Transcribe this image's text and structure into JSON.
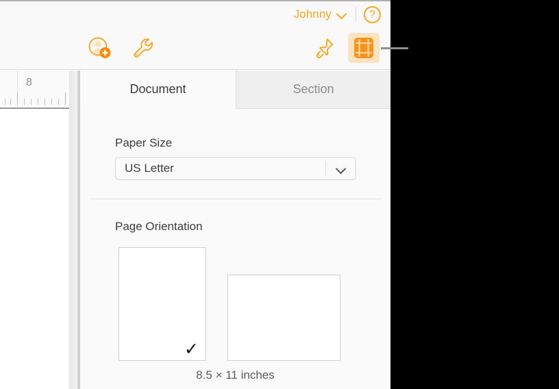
{
  "window": {
    "account_name": "Johnny",
    "account_chevron_icon": "chevron-down-icon",
    "help_icon": "help-circle-icon"
  },
  "toolbar": {
    "buttons": [
      {
        "name": "add-collaborator-button",
        "icon": "person-add-icon",
        "active": false
      },
      {
        "name": "tools-button",
        "icon": "wrench-icon",
        "active": false
      },
      {
        "name": "format-button",
        "icon": "paintbrush-icon",
        "active": false
      },
      {
        "name": "document-setup-button",
        "icon": "document-setup-icon",
        "active": true
      }
    ]
  },
  "ruler": {
    "numbers": [
      "8"
    ]
  },
  "inspector": {
    "tabs": [
      {
        "label": "Document",
        "active": true
      },
      {
        "label": "Section",
        "active": false
      }
    ],
    "paper_size": {
      "label": "Paper Size",
      "value": "US Letter",
      "chevron_icon": "chevron-down-icon"
    },
    "page_orientation": {
      "label": "Page Orientation",
      "options": [
        {
          "name": "portrait",
          "selected": true,
          "check_glyph": "✓"
        },
        {
          "name": "landscape",
          "selected": false
        }
      ],
      "dimensions": "8.5 × 11 inches"
    }
  },
  "colors": {
    "accent": "#f5a623",
    "accent_bg": "#fbe3c2",
    "panel_bg": "#fafafa",
    "inactive_tab": "#efefef"
  }
}
